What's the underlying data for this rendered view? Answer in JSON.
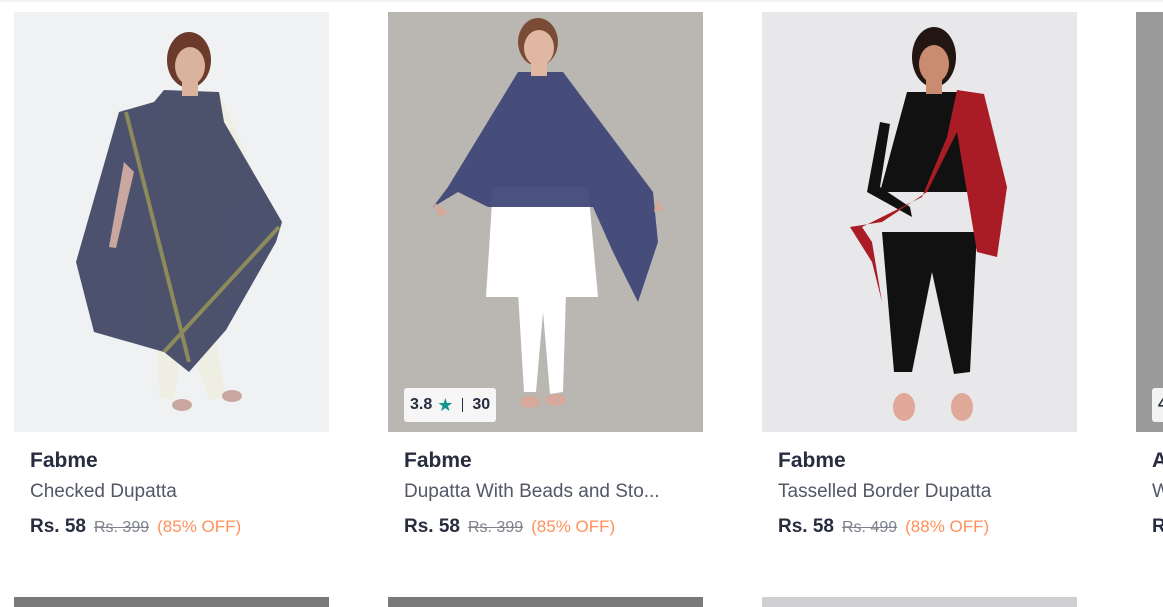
{
  "products": [
    {
      "brand": "Fabme",
      "title": "Checked Dupatta",
      "price": "Rs. 58",
      "mrp": "Rs. 399",
      "discount": "(85% OFF)",
      "image_bg": "#f0f1f3",
      "dupatta_color": "#3e4462",
      "top_color": "#efeee2",
      "bottom_color": "#efeee2"
    },
    {
      "brand": "Fabme",
      "title": "Dupatta With Beads and Sto...",
      "price": "Rs. 58",
      "mrp": "Rs. 399",
      "discount": "(85% OFF)",
      "rating": "3.8",
      "rating_count": "30",
      "image_bg": "#bab7b3",
      "dupatta_color": "#3d4576",
      "top_color": "#ffffff",
      "bottom_color": "#ffffff"
    },
    {
      "brand": "Fabme",
      "title": "Tasselled Border Dupatta",
      "price": "Rs. 58",
      "mrp": "Rs. 499",
      "discount": "(88% OFF)",
      "image_bg": "#e8e8ea",
      "dupatta_color": "#a91c25",
      "top_color": "#111111",
      "bottom_color": "#111111"
    },
    {
      "brand_partial": "A",
      "title_partial": "W",
      "price_partial": "R",
      "rating_partial": "4",
      "image_bg": "#9a9a9a"
    }
  ]
}
